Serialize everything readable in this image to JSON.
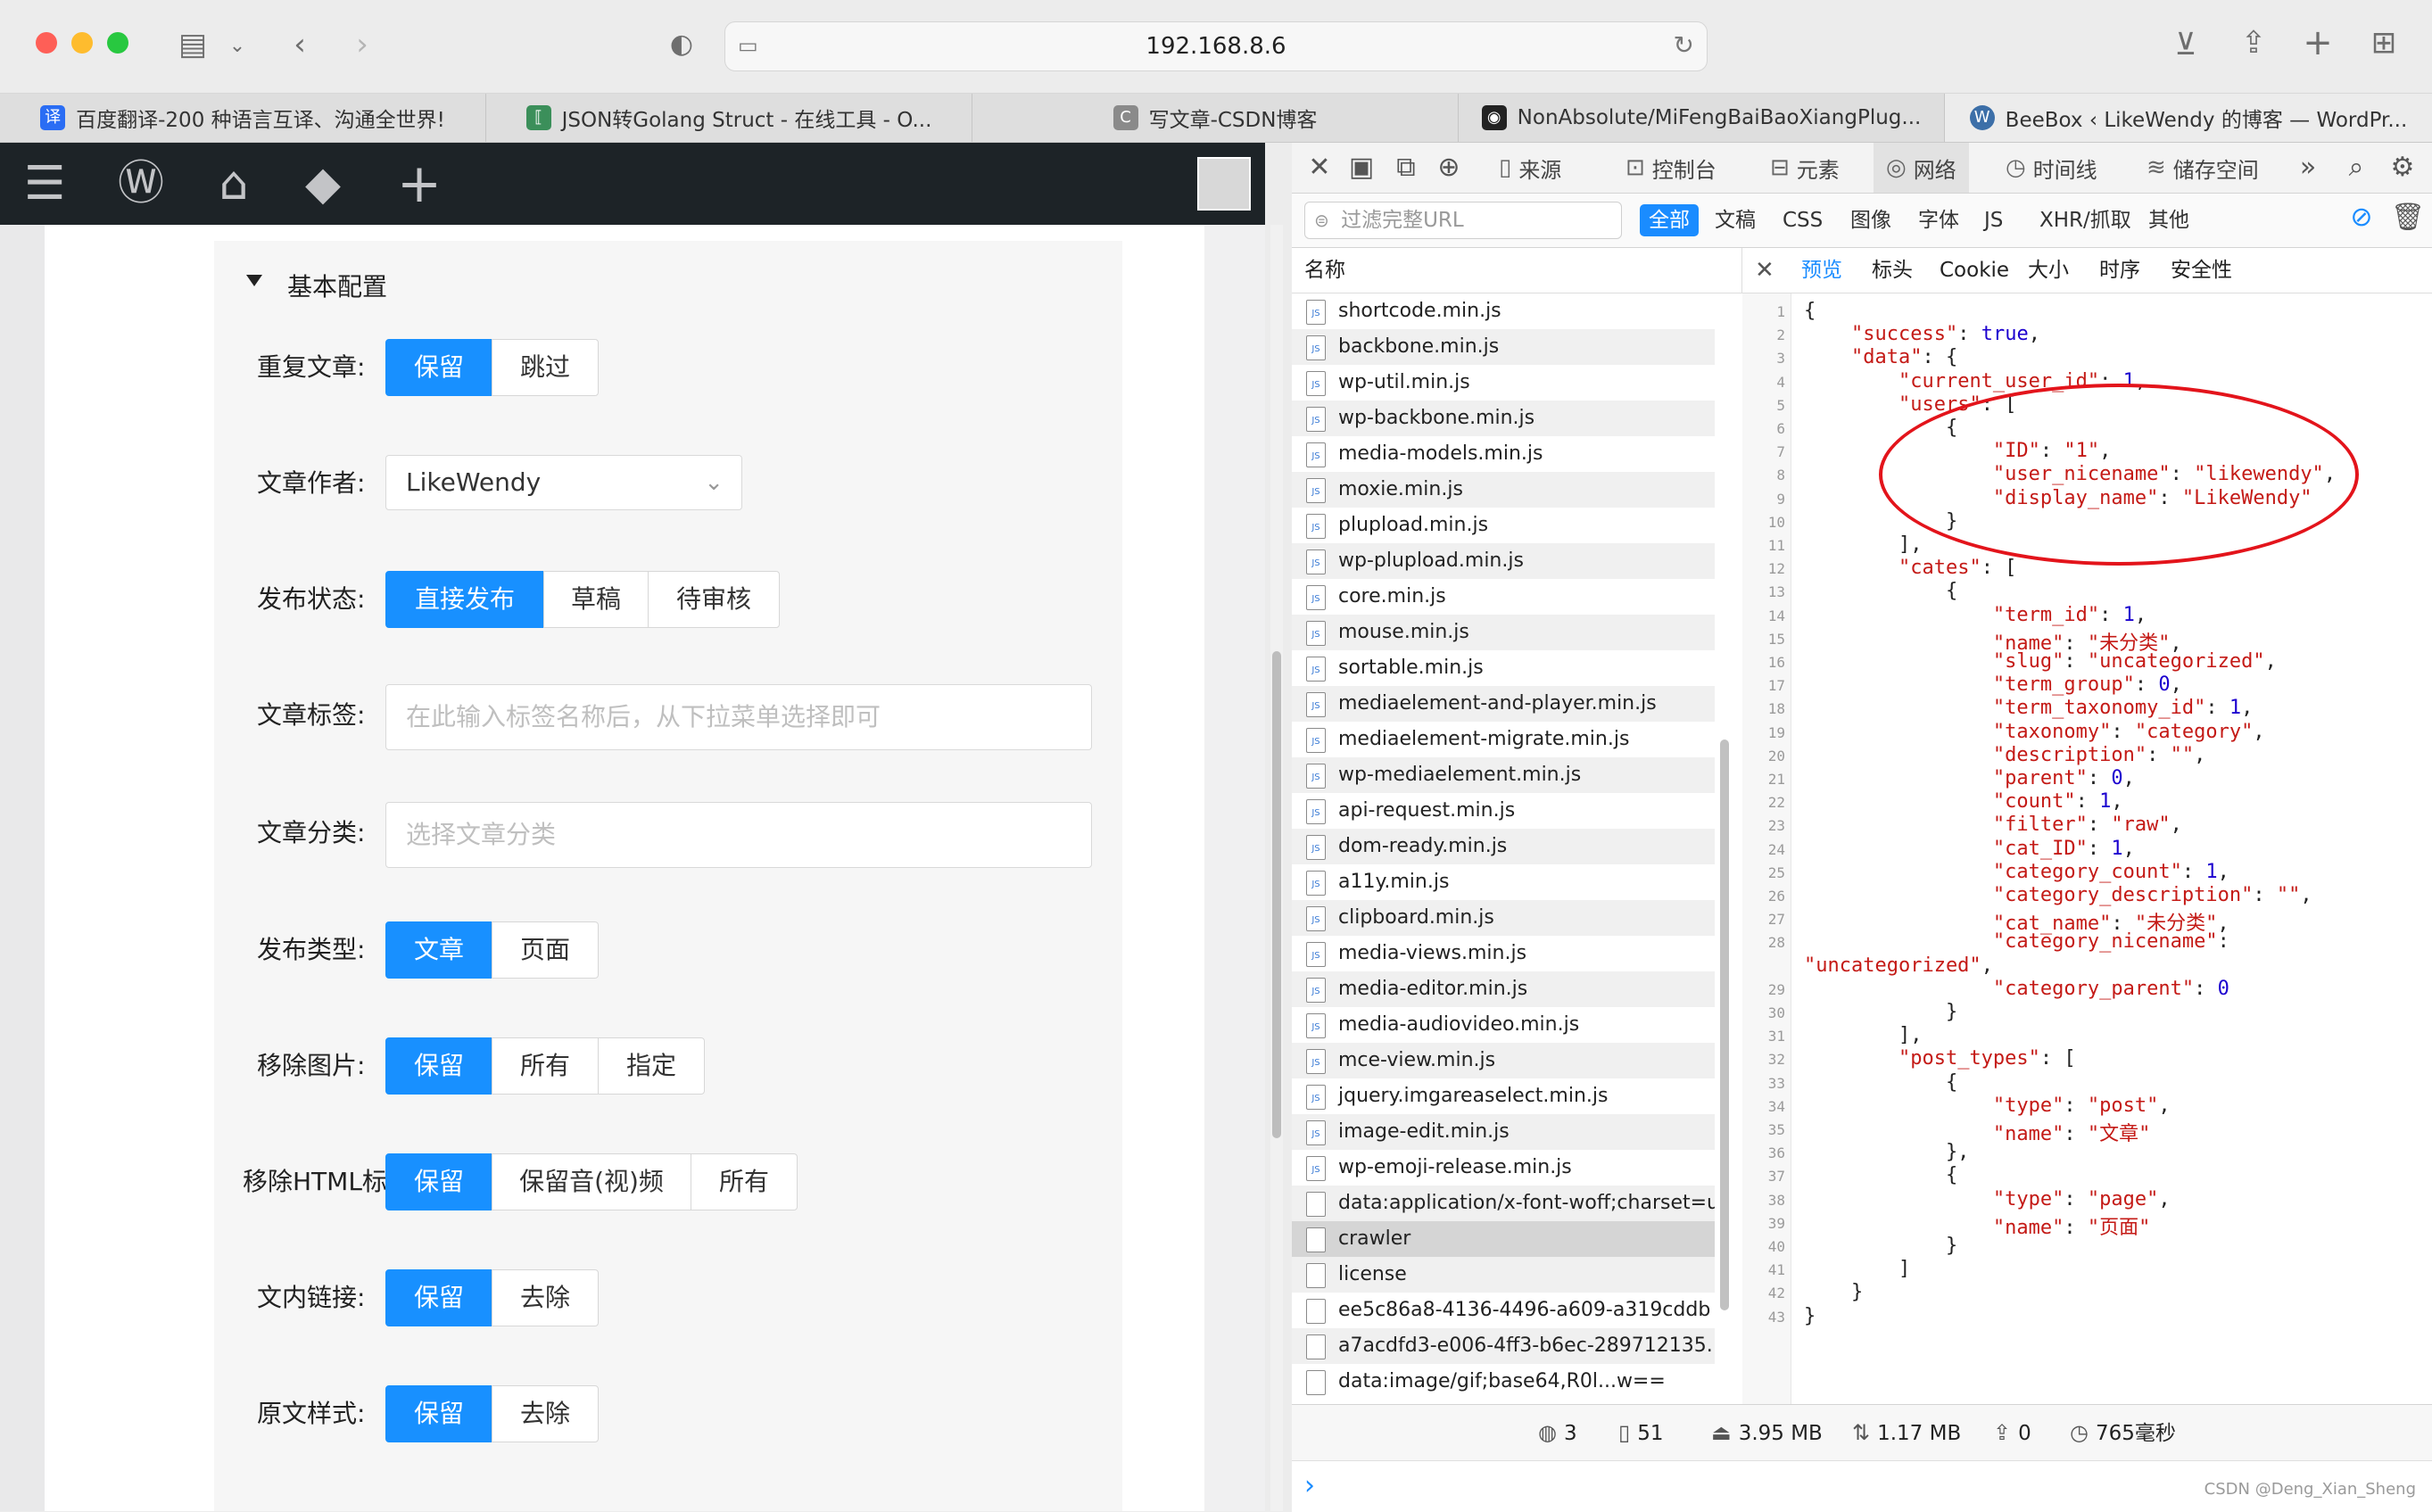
{
  "browser": {
    "url": "192.168.8.6",
    "tabs": [
      {
        "title": "百度翻译-200 种语言互译、沟通全世界!",
        "favicon": "译",
        "color": "#2a6df4"
      },
      {
        "title": "JSON转Golang Struct - 在线工具 - O...",
        "favicon": "⟦",
        "color": "#3b8f5a"
      },
      {
        "title": "写文章-CSDN博客",
        "favicon": "C",
        "color": "#8a8a8a"
      },
      {
        "title": "NonAbsolute/MiFengBaiBaoXiangPlug...",
        "favicon": "◉",
        "color": "#222222"
      },
      {
        "title": "BeeBox ‹ LikeWendy 的博客 — WordPr...",
        "favicon": "W",
        "color": "#3c6fa8"
      }
    ]
  },
  "form": {
    "section_title": "基本配置",
    "rows": [
      {
        "label": "重复文章:",
        "options": [
          "保留",
          "跳过"
        ],
        "selected": 0
      },
      {
        "label": "文章作者:",
        "select_value": "LikeWendy"
      },
      {
        "label": "发布状态:",
        "options": [
          "直接发布",
          "草稿",
          "待审核"
        ],
        "selected": 0
      },
      {
        "label": "文章标签:",
        "placeholder": "在此输入标签名称后，从下拉菜单选择即可"
      },
      {
        "label": "文章分类:",
        "placeholder": "选择文章分类"
      },
      {
        "label": "发布类型:",
        "options": [
          "文章",
          "页面"
        ],
        "selected": 0
      },
      {
        "label": "移除图片:",
        "options": [
          "保留",
          "所有",
          "指定"
        ],
        "selected": 0
      },
      {
        "label": "移除HTML标",
        "options": [
          "保留",
          "保留音(视)频",
          "所有"
        ],
        "selected": 0
      },
      {
        "label": "文内链接:",
        "options": [
          "保留",
          "去除"
        ],
        "selected": 0
      },
      {
        "label": "原文样式:",
        "options": [
          "保留",
          "去除"
        ],
        "selected": 0
      }
    ]
  },
  "devtools": {
    "tabs": [
      "来源",
      "控制台",
      "元素",
      "网络",
      "时间线",
      "储存空间"
    ],
    "active_tab": "网络",
    "filter_placeholder": "过滤完整URL",
    "filter_types": [
      "全部",
      "文稿",
      "CSS",
      "图像",
      "字体",
      "JS",
      "XHR/抓取",
      "其他"
    ],
    "list_header": "名称",
    "files": [
      "shortcode.min.js",
      "backbone.min.js",
      "wp-util.min.js",
      "wp-backbone.min.js",
      "media-models.min.js",
      "moxie.min.js",
      "plupload.min.js",
      "wp-plupload.min.js",
      "core.min.js",
      "mouse.min.js",
      "sortable.min.js",
      "mediaelement-and-player.min.js",
      "mediaelement-migrate.min.js",
      "wp-mediaelement.min.js",
      "api-request.min.js",
      "dom-ready.min.js",
      "a11y.min.js",
      "clipboard.min.js",
      "media-views.min.js",
      "media-editor.min.js",
      "media-audiovideo.min.js",
      "mce-view.min.js",
      "jquery.imgareaselect.min.js",
      "image-edit.min.js",
      "wp-emoji-release.min.js",
      "data:application/x-font-woff;charset=ut...",
      "crawler",
      "license",
      "ee5c86a8-4136-4496-a609-a319cddb",
      "a7acdfd3-e006-4ff3-b6ec-289712135...",
      "data:image/gif;base64,R0l...w=="
    ],
    "selected_file": "crawler",
    "preview_tabs": [
      "预览",
      "标头",
      "Cookie",
      "大小",
      "时序",
      "安全性"
    ],
    "active_preview_tab": "预览",
    "status": {
      "domains": "3",
      "resources": "51",
      "transferred": "3.95 MB",
      "size": "1.17 MB",
      "errors": "0",
      "time": "765毫秒"
    },
    "json_lines": [
      {
        "n": "1",
        "t": "{"
      },
      {
        "n": "2",
        "t": "    <k>\"success\"</k>: <b>true</b>,"
      },
      {
        "n": "3",
        "t": "    <k>\"data\"</k>: {"
      },
      {
        "n": "4",
        "t": "        <k>\"current_user_id\"</k>: <b>1</b>,"
      },
      {
        "n": "5",
        "t": "        <k>\"users\"</k>: ["
      },
      {
        "n": "6",
        "t": "            {"
      },
      {
        "n": "7",
        "t": "                <k>\"ID\"</k>: <k>\"1\"</k>,"
      },
      {
        "n": "8",
        "t": "                <k>\"user_nicename\"</k>: <k>\"likewendy\"</k>,"
      },
      {
        "n": "9",
        "t": "                <k>\"display_name\"</k>: <k>\"LikeWendy\"</k>"
      },
      {
        "n": "10",
        "t": "            }"
      },
      {
        "n": "11",
        "t": "        ],"
      },
      {
        "n": "12",
        "t": "        <k>\"cates\"</k>: ["
      },
      {
        "n": "13",
        "t": "            {"
      },
      {
        "n": "14",
        "t": "                <k>\"term_id\"</k>: <b>1</b>,"
      },
      {
        "n": "15",
        "t": "                <k>\"name\"</k>: <k>\"未分类\"</k>,"
      },
      {
        "n": "16",
        "t": "                <k>\"slug\"</k>: <k>\"uncategorized\"</k>,"
      },
      {
        "n": "17",
        "t": "                <k>\"term_group\"</k>: <b>0</b>,"
      },
      {
        "n": "18",
        "t": "                <k>\"term_taxonomy_id\"</k>: <b>1</b>,"
      },
      {
        "n": "19",
        "t": "                <k>\"taxonomy\"</k>: <k>\"category\"</k>,"
      },
      {
        "n": "20",
        "t": "                <k>\"description\"</k>: <k>\"\"</k>,"
      },
      {
        "n": "21",
        "t": "                <k>\"parent\"</k>: <b>0</b>,"
      },
      {
        "n": "22",
        "t": "                <k>\"count\"</k>: <b>1</b>,"
      },
      {
        "n": "23",
        "t": "                <k>\"filter\"</k>: <k>\"raw\"</k>,"
      },
      {
        "n": "24",
        "t": "                <k>\"cat_ID\"</k>: <b>1</b>,"
      },
      {
        "n": "25",
        "t": "                <k>\"category_count\"</k>: <b>1</b>,"
      },
      {
        "n": "26",
        "t": "                <k>\"category_description\"</k>: <k>\"\"</k>,"
      },
      {
        "n": "27",
        "t": "                <k>\"cat_name\"</k>: <k>\"未分类\"</k>,"
      },
      {
        "n": "28",
        "t": "                <k>\"category_nicename\"</k>:"
      },
      {
        "n": "",
        "t": "<k>\"uncategorized\"</k>,"
      },
      {
        "n": "29",
        "t": "                <k>\"category_parent\"</k>: <b>0</b>"
      },
      {
        "n": "30",
        "t": "            }"
      },
      {
        "n": "31",
        "t": "        ],"
      },
      {
        "n": "32",
        "t": "        <k>\"post_types\"</k>: ["
      },
      {
        "n": "33",
        "t": "            {"
      },
      {
        "n": "34",
        "t": "                <k>\"type\"</k>: <k>\"post\"</k>,"
      },
      {
        "n": "35",
        "t": "                <k>\"name\"</k>: <k>\"文章\"</k>"
      },
      {
        "n": "36",
        "t": "            },"
      },
      {
        "n": "37",
        "t": "            {"
      },
      {
        "n": "38",
        "t": "                <k>\"type\"</k>: <k>\"page\"</k>,"
      },
      {
        "n": "39",
        "t": "                <k>\"name\"</k>: <k>\"页面\"</k>"
      },
      {
        "n": "40",
        "t": "            }"
      },
      {
        "n": "41",
        "t": "        ]"
      },
      {
        "n": "42",
        "t": "    }"
      },
      {
        "n": "43",
        "t": "}"
      }
    ]
  },
  "watermark": "CSDN @Deng_Xian_Sheng"
}
